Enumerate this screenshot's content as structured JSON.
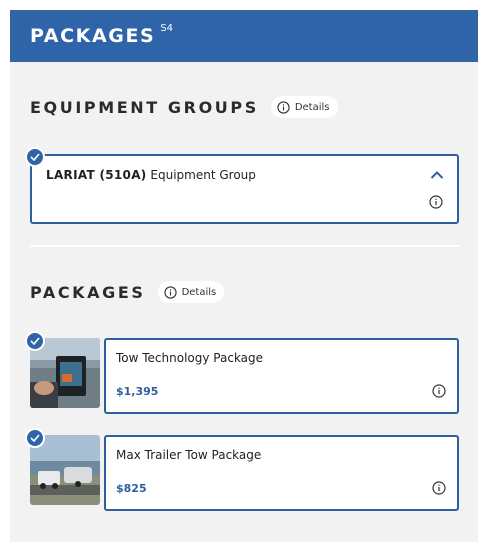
{
  "header": {
    "title": "PACKAGES",
    "superscript": "S4"
  },
  "equipment_groups": {
    "title": "EQUIPMENT GROUPS",
    "details_label": "Details",
    "selected_group": {
      "code_label": "LARIAT (510A)",
      "suffix": "Equipment Group",
      "selected": true,
      "expanded": true
    }
  },
  "packages": {
    "title": "PACKAGES",
    "details_label": "Details",
    "items": [
      {
        "name": "Tow Technology Package",
        "price": "$1,395",
        "selected": true,
        "thumb_icon": "truck-dashboard-photo"
      },
      {
        "name": "Max Trailer Tow Package",
        "price": "$825",
        "selected": true,
        "thumb_icon": "truck-towing-trailer-photo"
      }
    ]
  },
  "colors": {
    "brand_blue": "#2f64a8",
    "border_blue": "#2f5f9e",
    "panel_bg": "#f2f2f2"
  }
}
